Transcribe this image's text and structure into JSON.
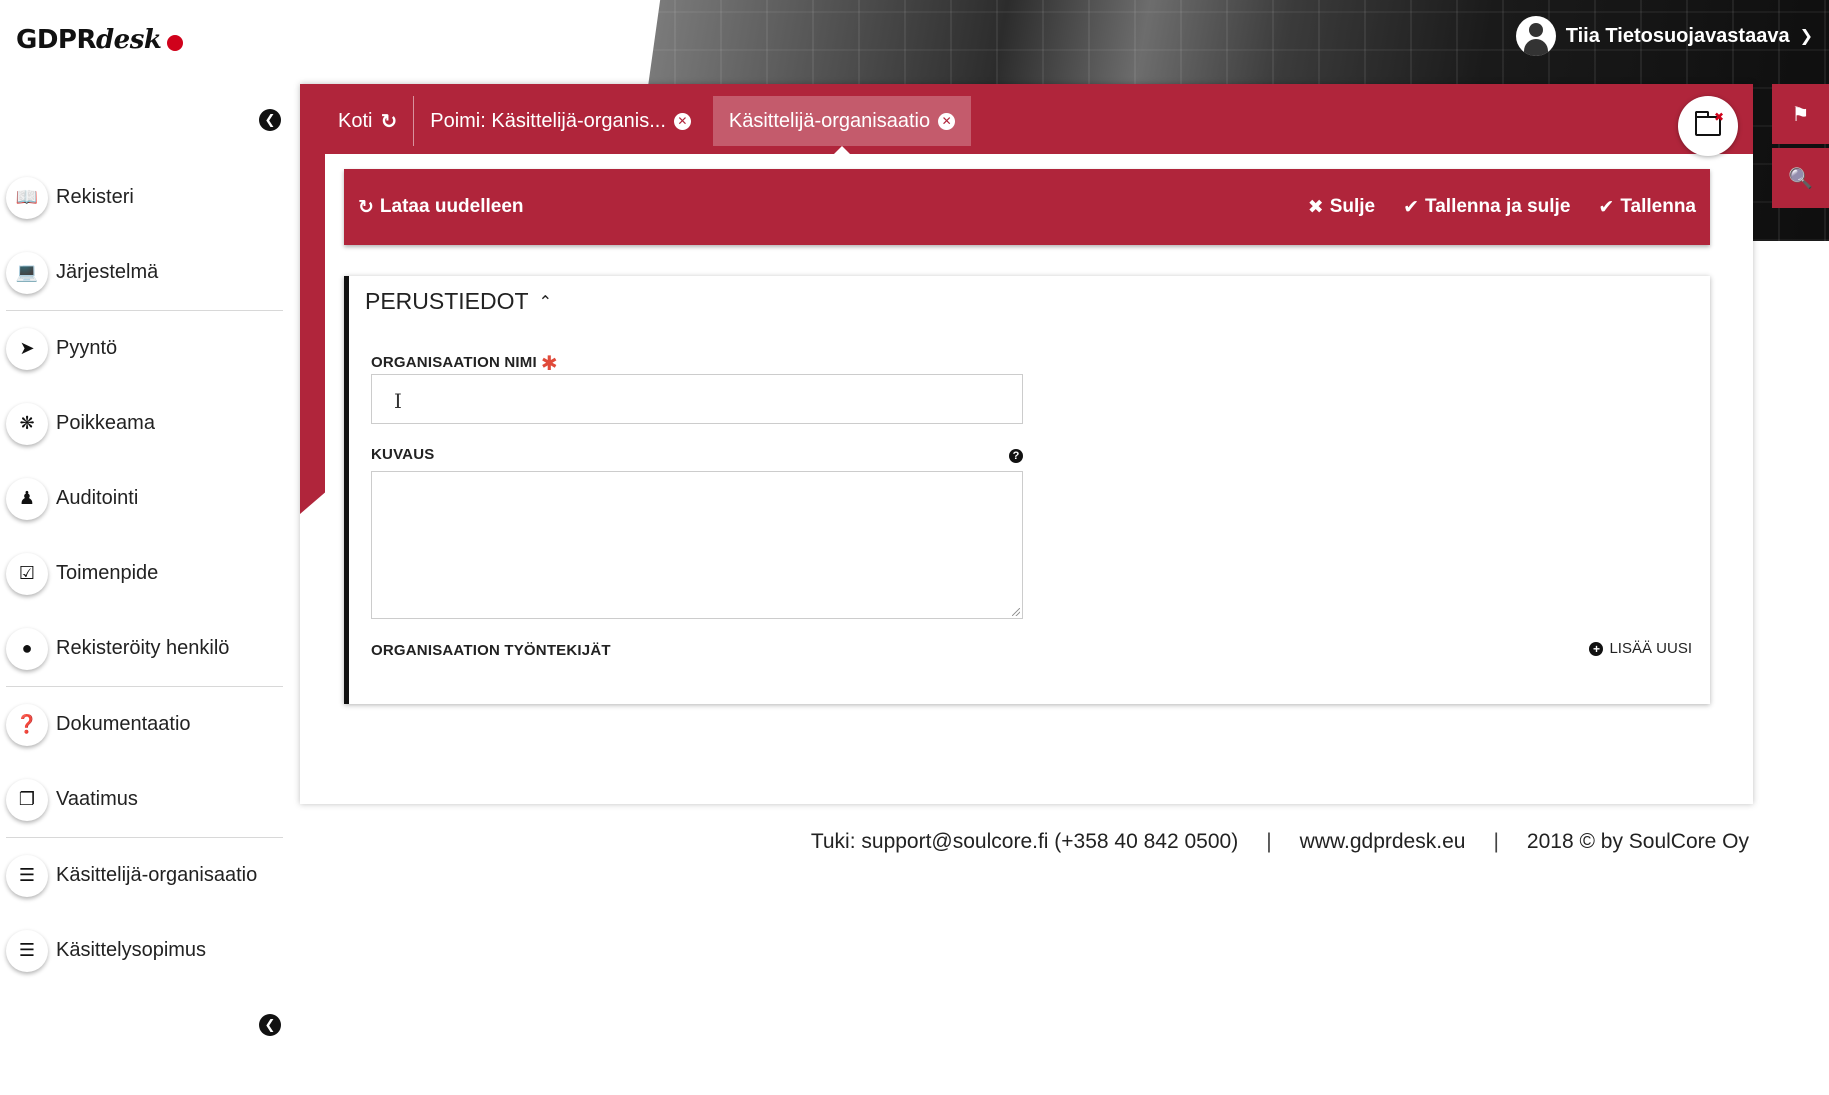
{
  "brand": {
    "name_main": "GDPR",
    "name_script": "desk",
    "accent": "#d0021b"
  },
  "user": {
    "name": "Tiia Tietosuojavastaava"
  },
  "colors": {
    "primary": "#b0253b",
    "text": "#222222"
  },
  "sidebar": {
    "items": [
      {
        "label": "Rekisteri",
        "icon": "book-icon"
      },
      {
        "label": "Järjestelmä",
        "icon": "laptop-icon"
      },
      {
        "label": "Pyyntö",
        "icon": "sign-in-icon"
      },
      {
        "label": "Poikkeama",
        "icon": "bug-icon"
      },
      {
        "label": "Auditointi",
        "icon": "auditor-icon"
      },
      {
        "label": "Toimenpide",
        "icon": "checkbox-icon"
      },
      {
        "label": "Rekisteröity henkilö",
        "icon": "user-icon"
      },
      {
        "label": "Dokumentaatio",
        "icon": "question-icon"
      },
      {
        "label": "Vaatimus",
        "icon": "clone-icon"
      },
      {
        "label": "Käsittelijä-organisaatio",
        "icon": "list-icon"
      },
      {
        "label": "Käsittelysopimus",
        "icon": "list-icon"
      }
    ]
  },
  "tabs": [
    {
      "label": "Koti"
    },
    {
      "label": "Poimi: Käsittelijä-organis..."
    },
    {
      "label": "Käsittelijä-organisaatio"
    }
  ],
  "toolbar": {
    "reload": "Lataa uudelleen",
    "close": "Sulje",
    "save_close": "Tallenna ja sulje",
    "save": "Tallenna"
  },
  "form": {
    "section_title": "PERUSTIEDOT",
    "org_name_label": "ORGANISAATION NIMI",
    "org_name_value": "",
    "description_label": "KUVAUS",
    "description_value": "",
    "employees_label": "ORGANISAATION TYÖNTEKIJÄT",
    "add_new": "LISÄÄ UUSI"
  },
  "footer": {
    "support": "Tuki:  support@soulcore.fi   (+358 40 842 0500)",
    "website": "www.gdprdesk.eu",
    "copyright": "2018 © by SoulCore Oy"
  }
}
